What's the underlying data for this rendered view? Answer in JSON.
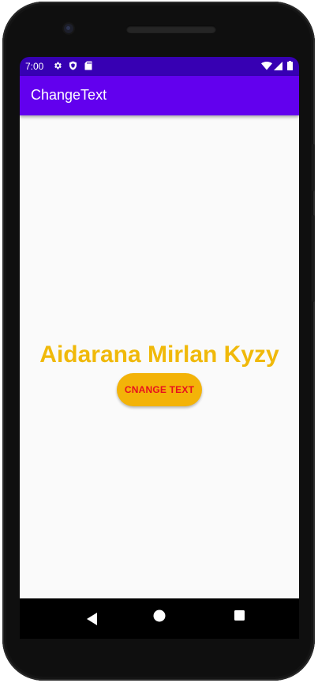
{
  "status_bar": {
    "time": "7:00",
    "icons": [
      "settings-gear-icon",
      "shield-icon",
      "sd-card-icon",
      "wifi-icon",
      "cell-signal-icon",
      "battery-icon"
    ]
  },
  "app_bar": {
    "title": "ChangeText"
  },
  "main": {
    "name_text": "Aidarana Mirlan Kyzy",
    "button_label": "CNANGE TEXT"
  },
  "nav_bar": {
    "icons": [
      "back-icon",
      "home-icon",
      "recents-icon"
    ]
  },
  "colors": {
    "status_bar": "#3700b3",
    "app_bar": "#6200ee",
    "name_text": "#f0b90a",
    "button_bg": "#f3b308",
    "button_text": "#e8101e",
    "content_bg": "#fafafa"
  }
}
